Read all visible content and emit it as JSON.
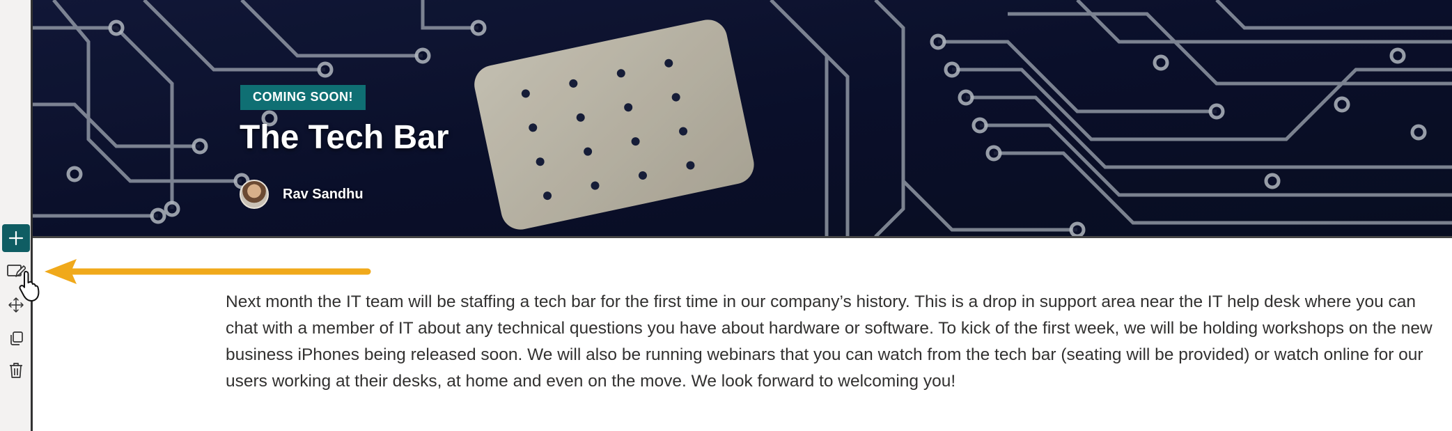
{
  "toolbar": {
    "buttons": [
      {
        "name": "add-section",
        "icon": "plus-icon"
      },
      {
        "name": "edit-properties",
        "icon": "edit-icon"
      },
      {
        "name": "move",
        "icon": "move-icon"
      },
      {
        "name": "duplicate",
        "icon": "duplicate-icon"
      },
      {
        "name": "delete",
        "icon": "trash-icon"
      }
    ]
  },
  "hero": {
    "badge": "COMING SOON!",
    "title": "The Tech Bar",
    "author": "Rav Sandhu",
    "badge_color": "#0f6f73"
  },
  "content": {
    "body": "Next month the IT team will be staffing a tech bar for the first time in our company’s history. This is a drop in support area near the IT help desk where you can chat with a member of IT about any technical questions you have about hardware or software. To kick of the first week, we will be holding workshops on the new business iPhones being released soon. We will also be running webinars that you can watch from the tech bar (seating will be provided) or watch online for our users working at their desks, at home and even on the move. We look forward to welcoming you!"
  },
  "annotation": {
    "arrow_color": "#f0a91b"
  }
}
